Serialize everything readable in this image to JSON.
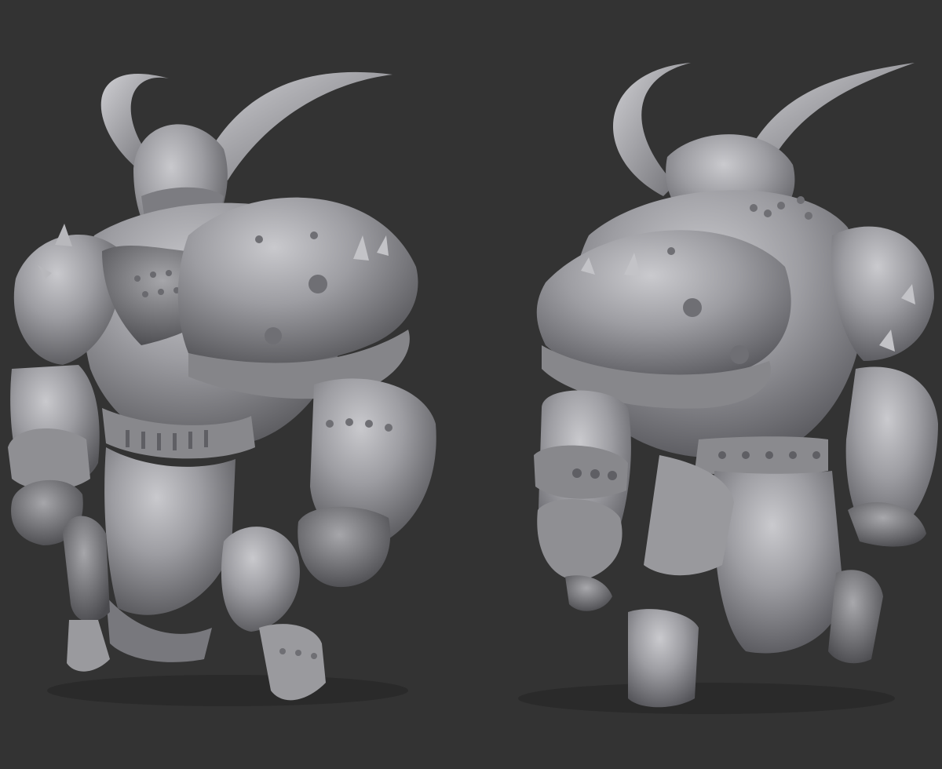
{
  "scene": {
    "background_color": "#333333",
    "material_color": "#9a9a9e",
    "views": [
      {
        "view": "front-three-quarter"
      },
      {
        "view": "back-three-quarter"
      }
    ]
  }
}
